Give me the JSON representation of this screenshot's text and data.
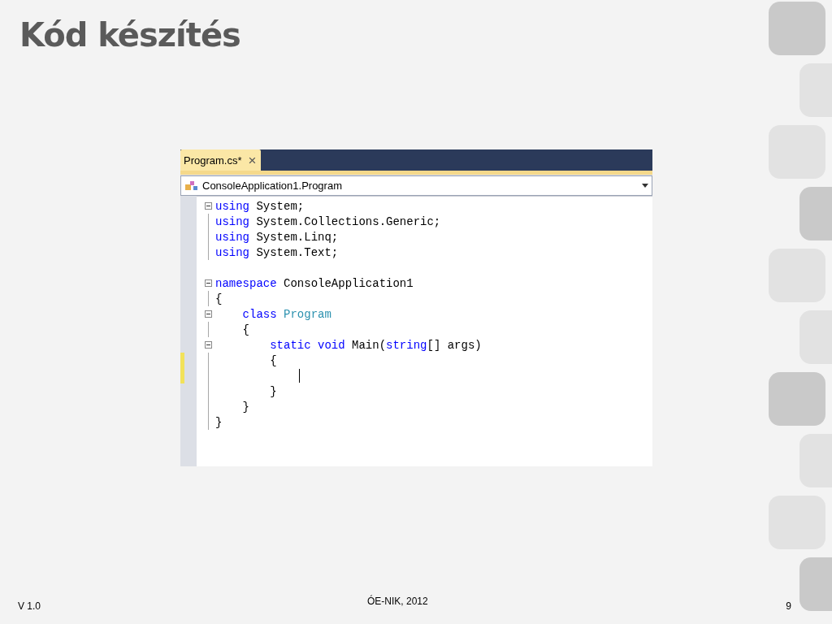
{
  "slide": {
    "title": "Kód készítés"
  },
  "editor": {
    "tab": {
      "label": "Program.cs*",
      "close": "×",
      "selected": true
    },
    "navigation": {
      "label": "ConsoleApplication1.Program"
    },
    "lines": [
      {
        "fold_marker": true,
        "changed": false,
        "caret": false,
        "tokens": [
          {
            "kind": "keyword",
            "text": "using"
          },
          {
            "kind": "plain",
            "text": " System;"
          }
        ]
      },
      {
        "fold_marker": false,
        "changed": false,
        "caret": false,
        "tokens": [
          {
            "kind": "keyword",
            "text": "using"
          },
          {
            "kind": "plain",
            "text": " System.Collections.Generic;"
          }
        ]
      },
      {
        "fold_marker": false,
        "changed": false,
        "caret": false,
        "tokens": [
          {
            "kind": "keyword",
            "text": "using"
          },
          {
            "kind": "plain",
            "text": " System.Linq;"
          }
        ]
      },
      {
        "fold_marker": false,
        "changed": false,
        "caret": false,
        "tokens": [
          {
            "kind": "keyword",
            "text": "using"
          },
          {
            "kind": "plain",
            "text": " System.Text;"
          }
        ]
      },
      {
        "fold_marker": false,
        "changed": false,
        "caret": false
      },
      {
        "fold_marker": true,
        "changed": false,
        "caret": false,
        "tokens": [
          {
            "kind": "keyword",
            "text": "namespace"
          },
          {
            "kind": "plain",
            "text": " ConsoleApplication1"
          }
        ]
      },
      {
        "fold_marker": false,
        "changed": false,
        "caret": false,
        "tokens": [
          {
            "kind": "plain",
            "text": "{"
          }
        ]
      },
      {
        "fold_marker": true,
        "changed": false,
        "caret": false,
        "tokens": [
          {
            "kind": "keyword",
            "text": "    class"
          },
          {
            "kind": "type",
            "text": " Program"
          }
        ]
      },
      {
        "fold_marker": false,
        "changed": false,
        "caret": false,
        "tokens": [
          {
            "kind": "plain",
            "text": "    {"
          }
        ]
      },
      {
        "fold_marker": true,
        "changed": false,
        "caret": false,
        "tokens": [
          {
            "kind": "keyword",
            "text": "        static"
          },
          {
            "kind": "keyword",
            "text": " void"
          },
          {
            "kind": "plain",
            "text": " Main("
          },
          {
            "kind": "keyword",
            "text": "string"
          },
          {
            "kind": "plain",
            "text": "[] args)"
          }
        ]
      },
      {
        "fold_marker": false,
        "changed": true,
        "caret": false,
        "tokens": [
          {
            "kind": "plain",
            "text": "        {"
          }
        ]
      },
      {
        "fold_marker": false,
        "changed": true,
        "caret": true
      },
      {
        "fold_marker": false,
        "changed": false,
        "caret": false,
        "tokens": [
          {
            "kind": "plain",
            "text": "        }"
          }
        ]
      },
      {
        "fold_marker": false,
        "changed": false,
        "caret": false,
        "tokens": [
          {
            "kind": "plain",
            "text": "    }"
          }
        ]
      },
      {
        "fold_marker": false,
        "changed": false,
        "caret": false,
        "tokens": [
          {
            "kind": "plain",
            "text": "}"
          }
        ]
      }
    ]
  },
  "footer": {
    "version": "V 1.0",
    "credit": "ÓE-NIK, 2012",
    "page": "9"
  }
}
